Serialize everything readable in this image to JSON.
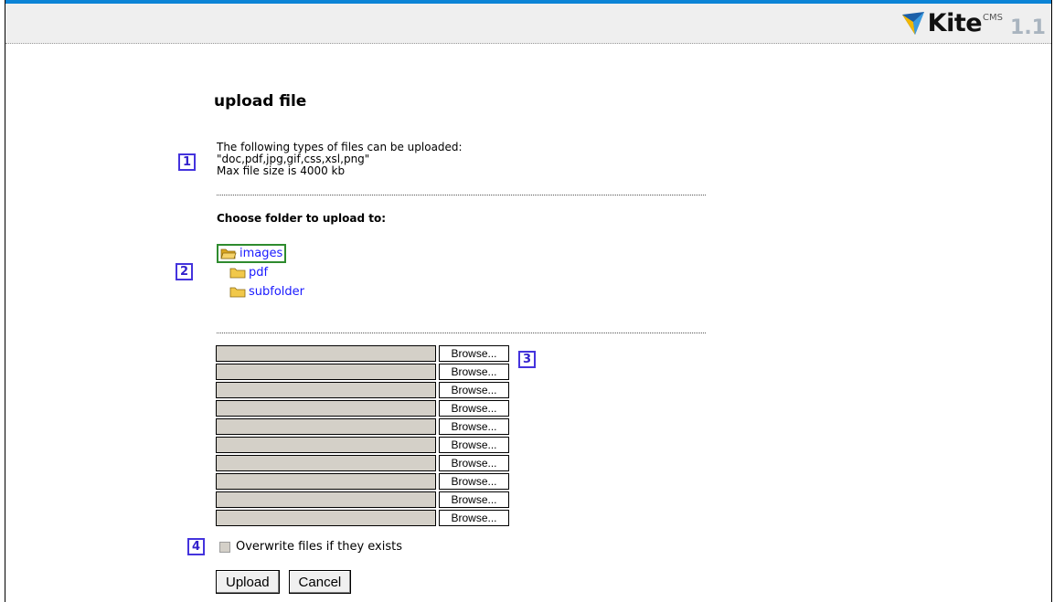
{
  "branding": {
    "name": "Kite",
    "superscript": "CMS",
    "version": "1.1"
  },
  "page": {
    "title": "upload file"
  },
  "info": {
    "line1": "The following types of files can be uploaded:",
    "line2": "\"doc,pdf,jpg,gif,css,xsl,png\"",
    "line3": "Max file size is 4000 kb"
  },
  "folders": {
    "heading": "Choose folder to upload to:",
    "items": [
      {
        "label": "images",
        "selected": true
      },
      {
        "label": "pdf",
        "selected": false
      },
      {
        "label": "subfolder",
        "selected": false
      }
    ]
  },
  "files": {
    "browse_label": "Browse...",
    "rows": 10
  },
  "options": {
    "overwrite_label": "Overwrite files if they exists",
    "overwrite_checked": false
  },
  "actions": {
    "upload_label": "Upload",
    "cancel_label": "Cancel"
  },
  "markers": [
    "1",
    "2",
    "3",
    "4"
  ],
  "colors": {
    "top_border": "#0b84d6",
    "link": "#1a1aff",
    "selection_border": "#2e8b2e",
    "marker": "#4433dd"
  }
}
